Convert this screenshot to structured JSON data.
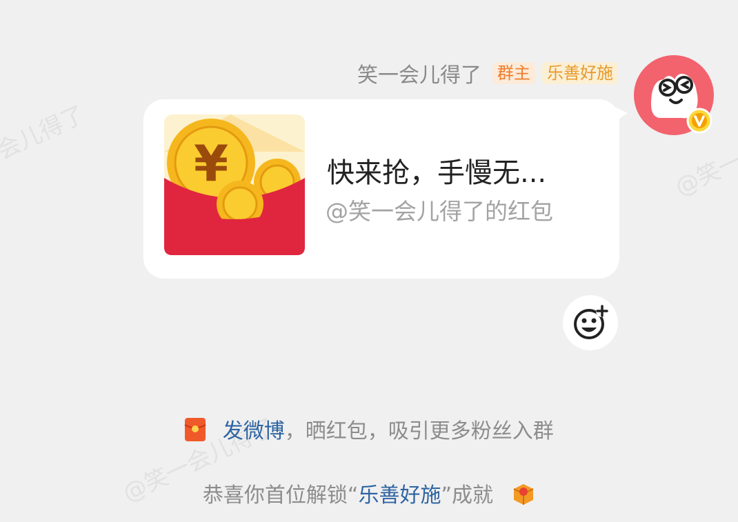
{
  "watermark": {
    "left_fragment": "会儿得了",
    "right_fragment": "@笑一",
    "bottom": "@笑一会儿得了"
  },
  "message": {
    "sender_name": "笑一会儿得了",
    "badges": [
      "群主",
      "乐善好施"
    ],
    "red_packet": {
      "title": "快来抢，手慢无...",
      "subtitle": "@笑一会儿得了的红包"
    }
  },
  "icons": {
    "avatar": "frog-face-avatar-icon",
    "verified": "verified-v-icon",
    "envelope": "red-packet-envelope-icon",
    "reaction": "add-reaction-emoji-icon",
    "system_red_packet": "red-packet-small-icon",
    "achievement": "achievement-gift-icon"
  },
  "system": {
    "line1": {
      "link": "发微博",
      "rest": "，晒红包，吸引更多粉丝入群"
    },
    "line2": {
      "prefix": "恭喜你首位解锁“",
      "achievement": "乐善好施",
      "suffix": "”成就"
    }
  },
  "colors": {
    "background": "#f0f0f0",
    "bubble": "#ffffff",
    "link": "#2e64a1",
    "envelope_red": "#e0263f",
    "coin_gold": "#f5b71d",
    "avatar_pink": "#f2636e",
    "badge_owner_text": "#f07c2b",
    "badge_achieve_text": "#e79a2a"
  }
}
